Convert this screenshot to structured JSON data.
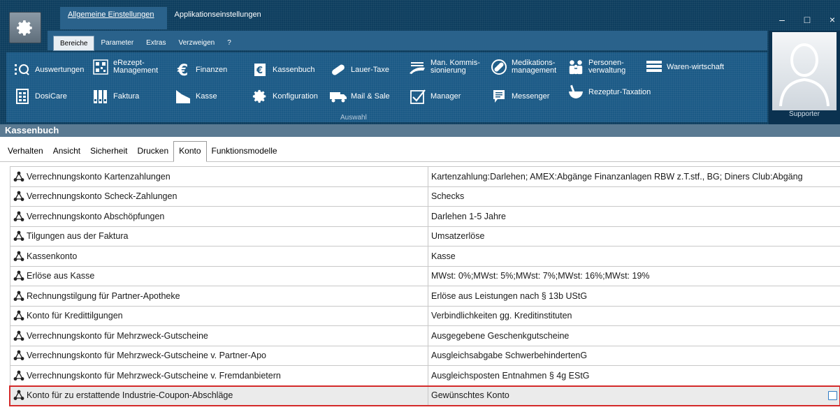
{
  "top_tabs": [
    {
      "label": "Allgemeine Einstellungen",
      "active": true
    },
    {
      "label": "Applikationseinstellungen",
      "active": false
    }
  ],
  "window_controls": {
    "minimize": "–",
    "maximize": "□",
    "close": "×"
  },
  "sub_tabs": [
    {
      "label": "Bereiche",
      "active": true
    },
    {
      "label": "Parameter",
      "active": false
    },
    {
      "label": "Extras",
      "active": false
    },
    {
      "label": "Verzweigen",
      "active": false
    },
    {
      "label": "?",
      "active": false
    }
  ],
  "ribbon": {
    "group_label": "Auswahl",
    "buttons": [
      {
        "label": "Auswertungen",
        "icon": "report-icon"
      },
      {
        "label": "DosiCare",
        "icon": "dosicare-icon"
      },
      {
        "label": "eRezept-Management",
        "icon": "erezept-icon"
      },
      {
        "label": "Faktura",
        "icon": "faktura-icon"
      },
      {
        "label": "Finanzen",
        "icon": "euro-icon"
      },
      {
        "label": "Kasse",
        "icon": "cash-register-icon"
      },
      {
        "label": "Kassenbuch",
        "icon": "cashbook-icon"
      },
      {
        "label": "Konfiguration",
        "icon": "gear-icon"
      },
      {
        "label": "Lauer-Taxe",
        "icon": "pill-icon"
      },
      {
        "label": "Mail & Sale",
        "icon": "truck-icon"
      },
      {
        "label": "Man. Kommis-sionierung",
        "icon": "picking-icon"
      },
      {
        "label": "Manager",
        "icon": "checkbox-icon"
      },
      {
        "label": "Medikations-management",
        "icon": "medication-icon"
      },
      {
        "label": "Messenger",
        "icon": "messenger-icon"
      },
      {
        "label": "Personen-verwaltung",
        "icon": "people-icon"
      },
      {
        "label": "Rezeptur-Taxation",
        "icon": "mortar-icon"
      },
      {
        "label": "Waren-wirtschaft",
        "icon": "warehouse-icon"
      }
    ]
  },
  "user": {
    "label": "Supporter"
  },
  "section_title": "Kassenbuch",
  "settings_tabs": [
    {
      "label": "Verhalten",
      "active": false
    },
    {
      "label": "Ansicht",
      "active": false
    },
    {
      "label": "Sicherheit",
      "active": false
    },
    {
      "label": "Drucken",
      "active": false
    },
    {
      "label": "Konto",
      "active": true
    },
    {
      "label": "Funktionsmodelle",
      "active": false
    }
  ],
  "rows": [
    {
      "label": "Verrechnungskonto Kartenzahlungen",
      "value": "Kartenzahlung:Darlehen; AMEX:Abgänge Finanzanlagen RBW z.T.stf., BG; Diners Club:Abgäng"
    },
    {
      "label": "Verrechnungskonto Scheck-Zahlungen",
      "value": "Schecks"
    },
    {
      "label": "Verrechnungskonto Abschöpfungen",
      "value": "Darlehen 1-5 Jahre"
    },
    {
      "label": "Tilgungen aus der Faktura",
      "value": "Umsatzerlöse"
    },
    {
      "label": "Kassenkonto",
      "value": "Kasse"
    },
    {
      "label": "Erlöse aus Kasse",
      "value": "MWst: 0%;MWst: 5%;MWst: 7%;MWst: 16%;MWst: 19%"
    },
    {
      "label": "Rechnungstilgung für Partner-Apotheke",
      "value": "Erlöse aus Leistungen nach § 13b UStG"
    },
    {
      "label": "Konto für Kredittilgungen",
      "value": "Verbindlichkeiten gg. Kreditinstituten"
    },
    {
      "label": "Verrechnungskonto für Mehrzweck-Gutscheine",
      "value": "Ausgegebene Geschenkgutscheine"
    },
    {
      "label": "Verrechnungskonto für Mehrzweck-Gutscheine v. Partner-Apo",
      "value": "Ausgleichsabgabe SchwerbehindertenG"
    },
    {
      "label": "Verrechnungskonto für Mehrzweck-Gutscheine v. Fremdanbietern",
      "value": "Ausgleichsposten Entnahmen § 4g EStG"
    },
    {
      "label": "Konto für zu erstattende Industrie-Coupon-Abschläge",
      "value": "Gewünschtes Konto",
      "selected": true
    }
  ],
  "colors": {
    "ribbon": "#0e3e5f",
    "panel": "#1b5a86",
    "selection_border": "#d42a2a",
    "section_header": "#5a7a92"
  }
}
